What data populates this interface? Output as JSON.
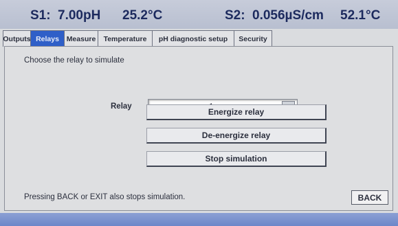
{
  "status": {
    "s1_label": "S1:",
    "s1_ph": "7.00pH",
    "s1_temp": "25.2°C",
    "s2_label": "S2:",
    "s2_conductivity": "0.056µS/cm",
    "s2_temp": "52.1°C"
  },
  "tabs": [
    {
      "label": "Outputs",
      "active": false
    },
    {
      "label": "Relays",
      "active": true
    },
    {
      "label": "Measure",
      "active": false
    },
    {
      "label": "Temperature",
      "active": false
    },
    {
      "label": "pH diagnostic setup",
      "active": false
    },
    {
      "label": "Security",
      "active": false
    }
  ],
  "panel": {
    "choose_text": "Choose the relay to simulate",
    "relay_label": "Relay",
    "relay_value": "1",
    "buttons": {
      "energize": "Energize relay",
      "deenergize": "De-energize relay",
      "stop": "Stop simulation"
    },
    "footer_text": "Pressing BACK or EXIT also stops simulation.",
    "back_label": "BACK"
  },
  "colors": {
    "active_tab": "#2f5fc8",
    "header_text": "#1c2a5e",
    "bottom_strip": "#6d86c9"
  }
}
